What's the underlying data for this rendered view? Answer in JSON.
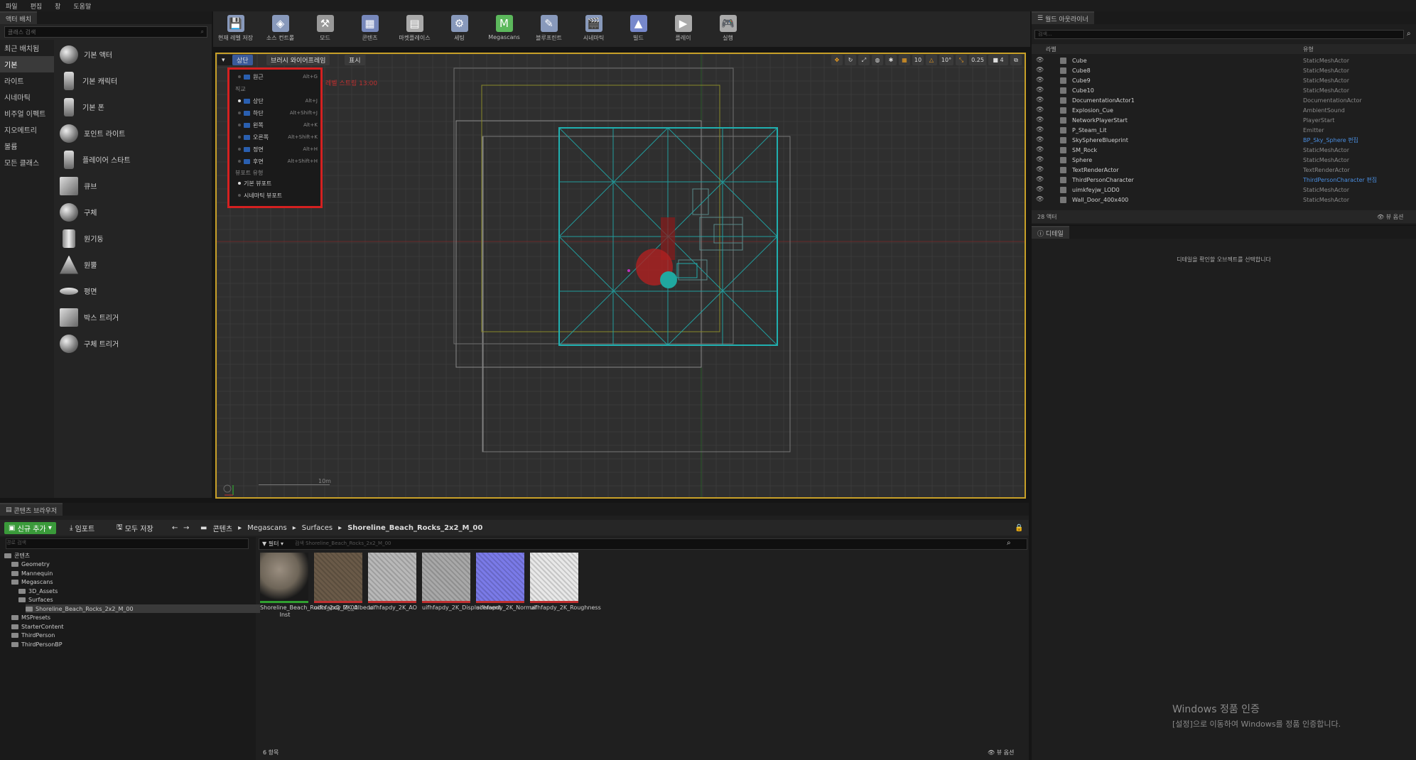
{
  "menu": [
    "파일",
    "편집",
    "창",
    "도움말"
  ],
  "place_panel": {
    "tab": "액터 배치",
    "search_placeholder": "클래스 검색",
    "categories": [
      "최근 배치됨",
      "기본",
      "라이트",
      "시네마틱",
      "비주얼 이펙트",
      "지오메트리",
      "볼륨",
      "모든 클래스"
    ],
    "selected_category": "기본",
    "items": [
      "기본 액터",
      "기본 캐릭터",
      "기본 폰",
      "포인트 라이트",
      "플레이어 스타트",
      "큐브",
      "구체",
      "원기둥",
      "원뿔",
      "평면",
      "박스 트리거",
      "구체 트리거"
    ]
  },
  "toolbar": [
    {
      "label": "현재 레벨 저장",
      "icon": "save-icon",
      "color": "#8899bb"
    },
    {
      "label": "소스 컨트롤",
      "icon": "source-control-icon",
      "color": "#8899bb"
    },
    {
      "label": "모드",
      "icon": "modes-icon",
      "color": "#999999"
    },
    {
      "label": "콘텐츠",
      "icon": "content-icon",
      "color": "#7788bb"
    },
    {
      "label": "마켓플레이스",
      "icon": "marketplace-icon",
      "color": "#aaaaaa"
    },
    {
      "label": "세팅",
      "icon": "settings-icon",
      "color": "#8899bb"
    },
    {
      "label": "Megascans",
      "icon": "megascans-icon",
      "color": "#5cb85c"
    },
    {
      "label": "블루프린트",
      "icon": "blueprint-icon",
      "color": "#8899bb"
    },
    {
      "label": "시네마틱",
      "icon": "cinematic-icon",
      "color": "#8899bb"
    },
    {
      "label": "빌드",
      "icon": "build-icon",
      "color": "#7788cc"
    },
    {
      "label": "플레이",
      "icon": "play-icon",
      "color": "#aaaaaa"
    },
    {
      "label": "실행",
      "icon": "launch-icon",
      "color": "#aaaaaa"
    }
  ],
  "viewport": {
    "view_button": "상단",
    "mode_button": "브러시 와이어프레임",
    "show_button": "표시",
    "snap_grid": "10",
    "snap_rot": "10°",
    "snap_scale": "0.25",
    "camera_speed": "4",
    "red_label": "레벨 스트링 13:00",
    "scale_label": "10m",
    "dropdown": {
      "perspective": {
        "label": "원근",
        "key": "Alt+G"
      },
      "ortho_header": "직교",
      "ortho": [
        {
          "label": "상단",
          "key": "Alt+J",
          "on": true
        },
        {
          "label": "하단",
          "key": "Alt+Shift+J",
          "on": false
        },
        {
          "label": "왼쪽",
          "key": "Alt+K",
          "on": false
        },
        {
          "label": "오른쪽",
          "key": "Alt+Shift+K",
          "on": false
        },
        {
          "label": "정면",
          "key": "Alt+H",
          "on": false
        },
        {
          "label": "후면",
          "key": "Alt+Shift+H",
          "on": false
        }
      ],
      "viewport_header": "뷰포트 유형",
      "viewport_types": [
        {
          "label": "기본 뷰포트",
          "on": true
        },
        {
          "label": "시네마틱 뷰포트",
          "on": false
        }
      ]
    }
  },
  "outliner": {
    "tab": "월드 아웃라이너",
    "search_placeholder": "검색...",
    "col_label": "라벨",
    "col_type": "유형",
    "rows": [
      {
        "name": "Cube",
        "type": "StaticMeshActor",
        "link": false
      },
      {
        "name": "Cube8",
        "type": "StaticMeshActor",
        "link": false
      },
      {
        "name": "Cube9",
        "type": "StaticMeshActor",
        "link": false
      },
      {
        "name": "Cube10",
        "type": "StaticMeshActor",
        "link": false
      },
      {
        "name": "DocumentationActor1",
        "type": "DocumentationActor",
        "link": false
      },
      {
        "name": "Explosion_Cue",
        "type": "AmbientSound",
        "link": false
      },
      {
        "name": "NetworkPlayerStart",
        "type": "PlayerStart",
        "link": false
      },
      {
        "name": "P_Steam_Lit",
        "type": "Emitter",
        "link": false
      },
      {
        "name": "SkySphereBlueprint",
        "type": "BP_Sky_Sphere 편집",
        "link": true
      },
      {
        "name": "SM_Rock",
        "type": "StaticMeshActor",
        "link": false
      },
      {
        "name": "Sphere",
        "type": "StaticMeshActor",
        "link": false
      },
      {
        "name": "TextRenderActor",
        "type": "TextRenderActor",
        "link": false
      },
      {
        "name": "ThirdPersonCharacter",
        "type": "ThirdPersonCharacter 편집",
        "link": true
      },
      {
        "name": "uimkfeyjw_LOD0",
        "type": "StaticMeshActor",
        "link": false
      },
      {
        "name": "Wall_Door_400x400",
        "type": "StaticMeshActor",
        "link": false
      }
    ],
    "count": "28 액터",
    "view_options": "뷰 옵션"
  },
  "details": {
    "tab": "디테일",
    "message": "디테일을 확인할 오브젝트를 선택합니다"
  },
  "watermark": {
    "title": "Windows 정품 인증",
    "sub": "[설정]으로 이동하여 Windows를 정품 인증합니다."
  },
  "content_browser": {
    "tab": "콘텐츠 브라우저",
    "add_new": "신규 추가",
    "import": "임포트",
    "save_all": "모두 저장",
    "breadcrumbs": [
      "콘텐츠",
      "Megascans",
      "Surfaces",
      "Shoreline_Beach_Rocks_2x2_M_00"
    ],
    "path_search_placeholder": "경로 검색",
    "filter_label": "필터",
    "asset_search_placeholder": "검색 Shoreline_Beach_Rocks_2x2_M_00",
    "tree": [
      {
        "label": "콘텐츠",
        "depth": 0
      },
      {
        "label": "Geometry",
        "depth": 1
      },
      {
        "label": "Mannequin",
        "depth": 1
      },
      {
        "label": "Megascans",
        "depth": 1
      },
      {
        "label": "3D_Assets",
        "depth": 2
      },
      {
        "label": "Surfaces",
        "depth": 2
      },
      {
        "label": "Shoreline_Beach_Rocks_2x2_M_00",
        "depth": 3
      },
      {
        "label": "MSPresets",
        "depth": 1
      },
      {
        "label": "StarterContent",
        "depth": 1
      },
      {
        "label": "ThirdPerson",
        "depth": 1
      },
      {
        "label": "ThirdPersonBP",
        "depth": 1
      }
    ],
    "selected_tree": "Shoreline_Beach_Rocks_2x2_M_00",
    "assets": [
      {
        "label": "Shoreline_Beach_Rocks_2x2_M_00 Inst",
        "kind": "sphere",
        "color": "#6e6558"
      },
      {
        "label": "uifhfapdy_2K_Albedo",
        "kind": "tex",
        "color": "#6a5a48"
      },
      {
        "label": "uifhfapdy_2K_AO",
        "kind": "tex",
        "color": "#b8b8b8"
      },
      {
        "label": "uifhfapdy_2K_Displacement",
        "kind": "tex",
        "color": "#a8a8a8"
      },
      {
        "label": "uifhfapdy_2K_Normal",
        "kind": "tex",
        "color": "#7a7ae8"
      },
      {
        "label": "uifhfapdy_2K_Roughness",
        "kind": "tex",
        "color": "#e8e8e8"
      }
    ],
    "item_count": "6 항목",
    "view_options": "뷰 옵션"
  }
}
